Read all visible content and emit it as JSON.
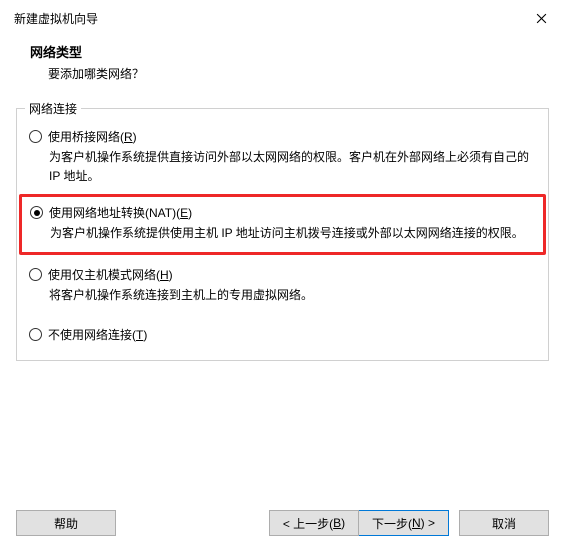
{
  "titlebar": {
    "title": "新建虚拟机向导"
  },
  "header": {
    "title": "网络类型",
    "subtitle": "要添加哪类网络？"
  },
  "fieldset": {
    "legend": "网络连接"
  },
  "options": {
    "bridged": {
      "label_prefix": "使用桥接网络(",
      "label_hotkey": "R",
      "label_suffix": ")",
      "description": "为客户机操作系统提供直接访问外部以太网网络的权限。客户机在外部网络上必须有自己的 IP 地址。"
    },
    "nat": {
      "label_prefix": "使用网络地址转换(NAT)(",
      "label_hotkey": "E",
      "label_suffix": ")",
      "description": "为客户机操作系统提供使用主机 IP 地址访问主机拨号连接或外部以太网网络连接的权限。"
    },
    "hostonly": {
      "label_prefix": "使用仅主机模式网络(",
      "label_hotkey": "H",
      "label_suffix": ")",
      "description": "将客户机操作系统连接到主机上的专用虚拟网络。"
    },
    "none": {
      "label_prefix": "不使用网络连接(",
      "label_hotkey": "T",
      "label_suffix": ")"
    }
  },
  "buttons": {
    "help": "帮助",
    "back_prefix": "< 上一步(",
    "back_hotkey": "B",
    "back_suffix": ")",
    "next_prefix": "下一步(",
    "next_hotkey": "N",
    "next_suffix": ") >",
    "cancel": "取消"
  }
}
